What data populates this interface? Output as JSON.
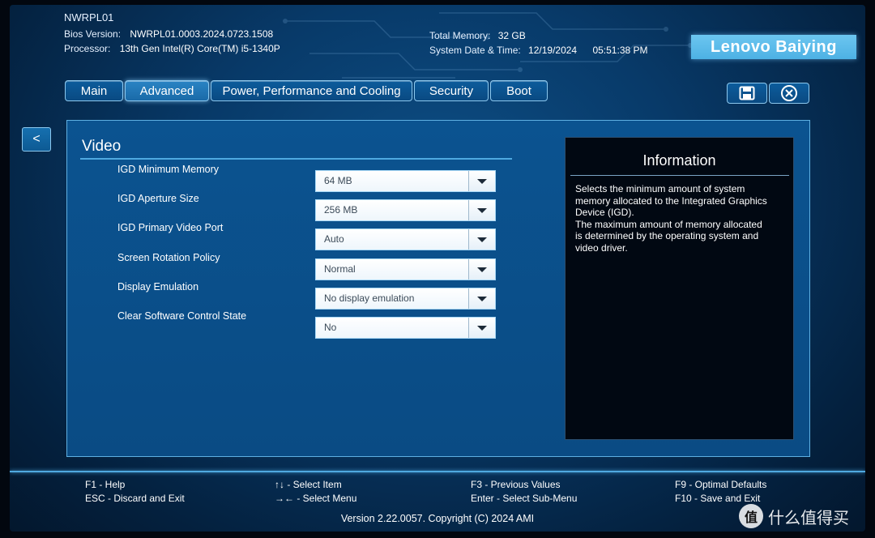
{
  "header": {
    "product": "NWRPL01",
    "bios_version_label": "Bios Version:",
    "bios_version": "NWRPL01.0003.2024.0723.1508",
    "processor_label": "Processor:",
    "processor": "13th Gen Intel(R) Core(TM) i5-1340P",
    "memory_label": "Total Memory:",
    "memory": "32 GB",
    "datetime_label": "System Date & Time:",
    "date": "12/19/2024",
    "time": "05:51:38 PM",
    "brand": "Lenovo Baiying"
  },
  "tabs": [
    {
      "label": "Main",
      "active": false
    },
    {
      "label": "Advanced",
      "active": true
    },
    {
      "label": "Power, Performance and Cooling",
      "active": false
    },
    {
      "label": "Security",
      "active": false
    },
    {
      "label": "Boot",
      "active": false
    }
  ],
  "back_label": "<",
  "section": {
    "title": "Video",
    "settings": [
      {
        "label": "IGD Minimum Memory",
        "value": "64 MB"
      },
      {
        "label": "IGD Aperture Size",
        "value": "256 MB"
      },
      {
        "label": "IGD Primary Video Port",
        "value": "Auto"
      },
      {
        "label": "Screen Rotation Policy",
        "value": "Normal"
      },
      {
        "label": "Display Emulation",
        "value": "No display emulation"
      },
      {
        "label": "Clear Software Control State",
        "value": "No"
      }
    ]
  },
  "info": {
    "title": "Information",
    "body": "Selects the minimum amount of system\nmemory allocated to the Integrated Graphics\nDevice (IGD).\nThe maximum amount of memory allocated\nis determined by the operating system and\nvideo driver."
  },
  "footer": {
    "f1": "F1 - Help",
    "esc": "ESC - Discard and Exit",
    "select_item": "↑↓ - Select Item",
    "select_menu": "→← - Select Menu",
    "f3": "F3 - Previous Values",
    "enter": "Enter - Select Sub-Menu",
    "f9": "F9 - Optimal Defaults",
    "f10": "F10 - Save and Exit",
    "version": "Version 2.22.0057. Copyright (C) 2024 AMI"
  },
  "watermark": {
    "badge": "值",
    "text": "什么值得买"
  }
}
